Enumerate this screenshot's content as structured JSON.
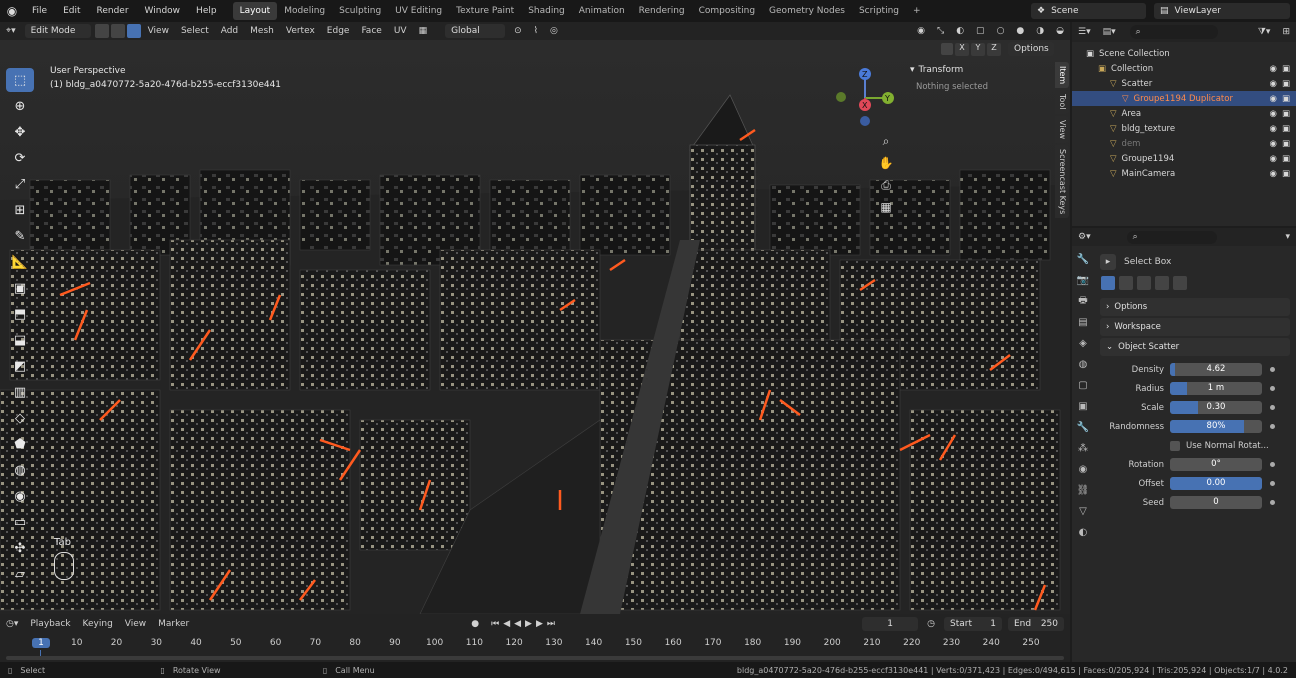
{
  "menu": {
    "items": [
      "File",
      "Edit",
      "Render",
      "Window",
      "Help"
    ]
  },
  "workspaces": {
    "tabs": [
      "Layout",
      "Modeling",
      "Sculpting",
      "UV Editing",
      "Texture Paint",
      "Shading",
      "Animation",
      "Rendering",
      "Compositing",
      "Geometry Nodes",
      "Scripting"
    ],
    "active": "Layout",
    "add": "+"
  },
  "scene": {
    "name": "Scene",
    "view_layer": "ViewLayer"
  },
  "viewport_header": {
    "mode": "Edit Mode",
    "menus": [
      "View",
      "Select",
      "Add",
      "Mesh",
      "Vertex",
      "Edge",
      "Face",
      "UV"
    ],
    "transform_orientation": "Global",
    "options_label": "Options",
    "axes": [
      "X",
      "Y",
      "Z"
    ]
  },
  "viewport": {
    "perspective": "User Perspective",
    "object_label": "(1) bldg_a0470772-5a20-476d-b255-eccf3130e441",
    "key_hint": "Tab",
    "side_tabs": [
      "Item",
      "Tool",
      "View",
      "Screencast Keys"
    ]
  },
  "npanel": {
    "title": "Transform",
    "empty_text": "Nothing selected"
  },
  "gizmo": {
    "x": "X",
    "y": "Y",
    "z": "Z"
  },
  "timeline": {
    "menus": [
      "Playback",
      "Keying",
      "View",
      "Marker"
    ],
    "current_frame": "1",
    "start_label": "Start",
    "start": "1",
    "end_label": "End",
    "end": "250",
    "ticks": [
      "1",
      "10",
      "20",
      "30",
      "40",
      "50",
      "60",
      "70",
      "80",
      "90",
      "100",
      "110",
      "120",
      "130",
      "140",
      "150",
      "160",
      "170",
      "180",
      "190",
      "200",
      "210",
      "220",
      "230",
      "240",
      "250"
    ]
  },
  "status": {
    "select": "Select",
    "rotate": "Rotate View",
    "menu": "Call Menu",
    "info": "bldg_a0470772-5a20-476d-b255-eccf3130e441 | Verts:0/371,423 | Edges:0/494,615 | Faces:0/205,924 | Tris:205,924 | Objects:1/7 | 4.0.2"
  },
  "outliner": {
    "root": "Scene Collection",
    "rows": [
      {
        "label": "Collection",
        "indent": 1
      },
      {
        "label": "Scatter",
        "indent": 2
      },
      {
        "label": "Groupe1194 Duplicator",
        "indent": 3,
        "selected": true
      },
      {
        "label": "Area",
        "indent": 2
      },
      {
        "label": "bldg_texture",
        "indent": 2
      },
      {
        "label": "dem",
        "indent": 2,
        "dim": true
      },
      {
        "label": "Groupe1194",
        "indent": 2
      },
      {
        "label": "MainCamera",
        "indent": 2
      }
    ]
  },
  "properties": {
    "tool_name": "Select Box",
    "sections": [
      "Options",
      "Workspace",
      "Object Scatter"
    ],
    "fields": [
      {
        "label": "Density",
        "value": "4.62",
        "fill": 0.05
      },
      {
        "label": "Radius",
        "value": "1 m",
        "fill": 0.18
      },
      {
        "label": "Scale",
        "value": "0.30",
        "fill": 0.3
      },
      {
        "label": "Randomness",
        "value": "80%",
        "fill": 0.8
      }
    ],
    "checkbox_label": "Use Normal Rotat...",
    "fields2": [
      {
        "label": "Rotation",
        "value": "0°",
        "fill": 0
      },
      {
        "label": "Offset",
        "value": "0.00",
        "fill": 1.0
      },
      {
        "label": "Seed",
        "value": "0",
        "fill": 0
      }
    ]
  },
  "colors": {
    "accent": "#4772b3",
    "crane": "#ff5a1f",
    "bg": "#1d1d1d"
  }
}
